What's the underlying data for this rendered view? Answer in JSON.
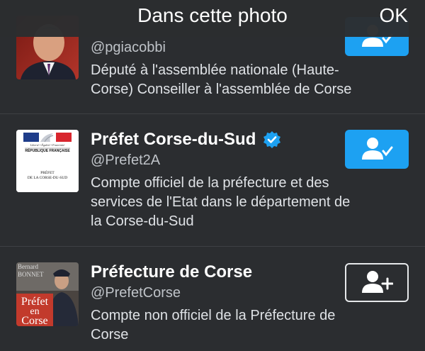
{
  "header": {
    "title": "Dans cette photo",
    "ok_label": "OK"
  },
  "colors": {
    "background": "#2b2d30",
    "accent": "#1da1f2",
    "verified": "#1da1f2"
  },
  "users": [
    {
      "handle": "@pgiacobbi",
      "bio_lines": [
        "Député à l'assemblée nationale (Haute-",
        "Corse) Conseiller à l'assemblée de Corse"
      ],
      "button_state": "following",
      "button_icon": "person-check-icon"
    },
    {
      "name": "Préfet Corse-du-Sud",
      "verified": true,
      "handle": "@Prefet2A",
      "avatar": {
        "motto": "Liberté • Égalité • Fraternité",
        "republic": "RÉPUBLIQUE FRANÇAISE",
        "prefet_line1": "PRÉFET",
        "prefet_line2": "DE LA CORSE-DU-SUD"
      },
      "bio_lines": [
        "Compte officiel de la préfecture et des",
        "services de l'Etat dans le département de",
        "la Corse-du-Sud"
      ],
      "button_state": "following",
      "button_icon": "person-check-icon"
    },
    {
      "name": "Préfecture de Corse",
      "handle": "@PrefetCorse",
      "avatar": {
        "poster_top1": "Bernard",
        "poster_top2": "BONNET",
        "poster_line1": "Préfet",
        "poster_line2": "en",
        "poster_line3": "Corse"
      },
      "bio_lines": [
        "Compte non officiel de la Préfecture de",
        "Corse"
      ],
      "button_state": "follow",
      "button_icon": "person-plus-icon"
    }
  ]
}
